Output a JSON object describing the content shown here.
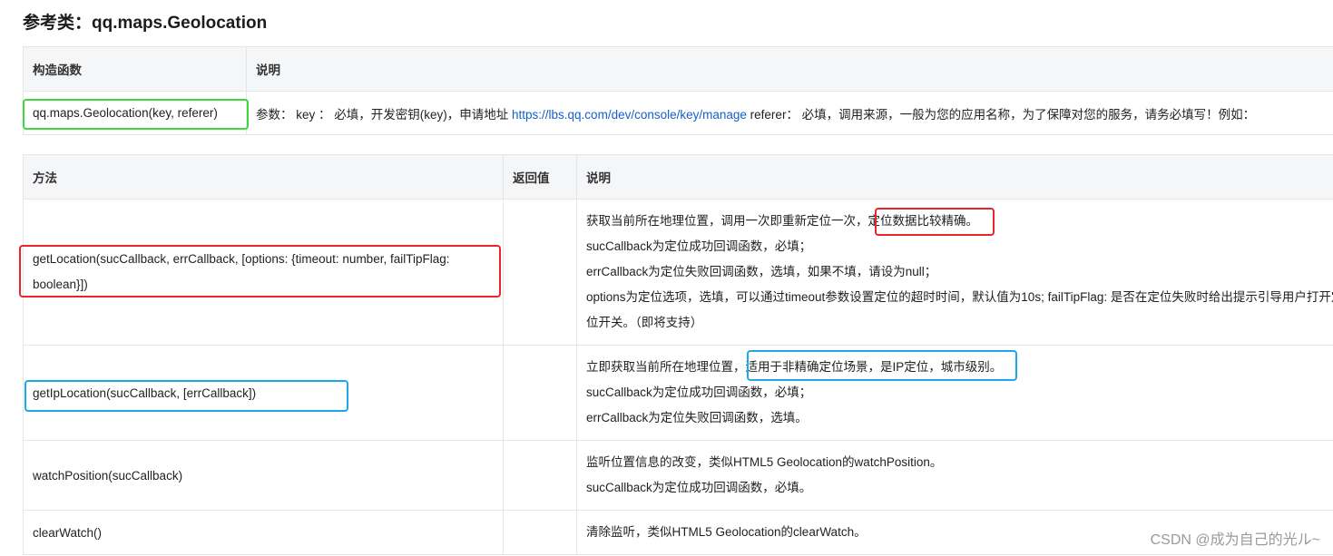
{
  "title": "参考类：qq.maps.Geolocation",
  "constructor_table": {
    "headers": [
      "构造函数",
      "说明"
    ],
    "signature": "qq.maps.Geolocation(key, referer)",
    "desc_prefix": "参数： key ： 必填，开发密钥(key)，申请地址 ",
    "desc_link": "https://lbs.qq.com/dev/console/key/manage",
    "desc_suffix": " referer： 必填，调用来源，一般为您的应用名称，为了保障对您的服务，请务必填写！例如："
  },
  "methods_table": {
    "headers": [
      "方法",
      "返回值",
      "说明"
    ],
    "rows": [
      {
        "sig_line1": "getLocation(sucCallback, errCallback, [options: {timeout: number, failTipFlag:",
        "sig_line2": "boolean}])",
        "returns": "",
        "desc_line1_a": "获取当前所在地理位置，调用一次即重新定位一次，",
        "desc_line1_b": "定位数据比较精确。",
        "desc_line2": "sucCallback为定位成功回调函数，必填；",
        "desc_line3": "errCallback为定位失败回调函数，选填，如果不填，请设为null；",
        "desc_line4": "options为定位选项，选填，可以通过timeout参数设置定位的超时时间，默认值为10s; failTipFlag: 是否在定位失败时给出提示引导用户打开定",
        "desc_line5": "位开关。（即将支持）"
      },
      {
        "sig": "getIpLocation(sucCallback, [errCallback])",
        "returns": "",
        "desc_line1_a": "立即获取当前所在地理位置，",
        "desc_line1_b": "适用于非精确定位场景，是IP定位，城市级别。",
        "desc_line2": "sucCallback为定位成功回调函数，必填；",
        "desc_line3": "errCallback为定位失败回调函数，选填。"
      },
      {
        "sig": "watchPosition(sucCallback)",
        "returns": "",
        "desc_line1": "监听位置信息的改变，类似HTML5 Geolocation的watchPosition。",
        "desc_line2": "sucCallback为定位成功回调函数，必填。"
      },
      {
        "sig": "clearWatch()",
        "returns": "",
        "desc_line1": "清除监听，类似HTML5 Geolocation的clearWatch。"
      }
    ]
  },
  "highlight_colors": {
    "green": "#3fd63f",
    "red": "#e8262a",
    "blue": "#1ea8ec"
  },
  "watermark": "CSDN @成为自己的光ル~"
}
